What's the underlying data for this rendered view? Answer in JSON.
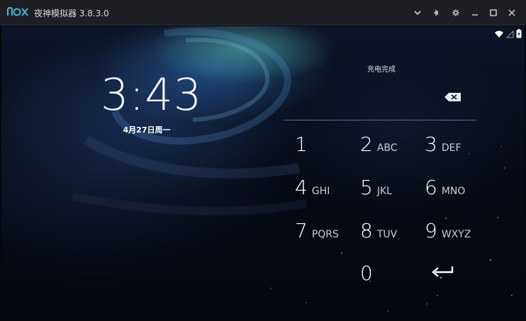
{
  "window": {
    "logo_text": "nox",
    "title": "夜神模拟器 3.8.3.0",
    "controls": [
      "chevron-down-icon",
      "pin-icon",
      "gear-icon",
      "minimize-icon",
      "maximize-icon",
      "close-icon"
    ]
  },
  "status_bar": {
    "icons": [
      "wifi-icon",
      "signal-icon",
      "battery-charging-icon"
    ]
  },
  "lockscreen": {
    "time": "3:43",
    "date": "4月27日周一",
    "charging_text": "充电完成"
  },
  "keypad": {
    "keys": [
      {
        "digit": "1",
        "letters": ""
      },
      {
        "digit": "2",
        "letters": "ABC"
      },
      {
        "digit": "3",
        "letters": "DEF"
      },
      {
        "digit": "4",
        "letters": "GHI"
      },
      {
        "digit": "5",
        "letters": "JKL"
      },
      {
        "digit": "6",
        "letters": "MNO"
      },
      {
        "digit": "7",
        "letters": "PQRS"
      },
      {
        "digit": "8",
        "letters": "TUV"
      },
      {
        "digit": "9",
        "letters": "WXYZ"
      },
      {
        "digit": "0",
        "letters": ""
      }
    ],
    "backspace_icon": "backspace-icon",
    "enter_icon": "enter-arrow-icon"
  }
}
